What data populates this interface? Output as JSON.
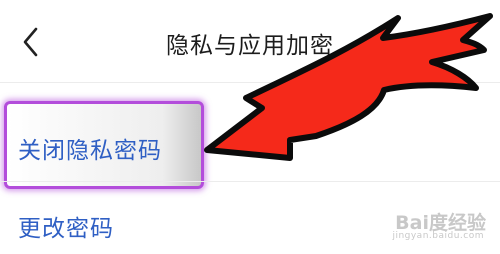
{
  "header": {
    "back_icon": "chevron-left-icon",
    "title": "隐私与应用加密"
  },
  "list": {
    "items": [
      {
        "label": "关闭隐私密码",
        "highlighted": true
      },
      {
        "label": "更改密码"
      }
    ]
  },
  "annotation": {
    "arrow_icon": "red-arrow-icon",
    "arrow_color": "#f5291a",
    "highlight_color": "#b34ddb"
  },
  "watermark": {
    "text": "Bai度经验",
    "sub": "jingyan.baidu.com"
  },
  "colors": {
    "label_blue": "#2f5fc4",
    "title_dark": "#1c1c1c"
  }
}
